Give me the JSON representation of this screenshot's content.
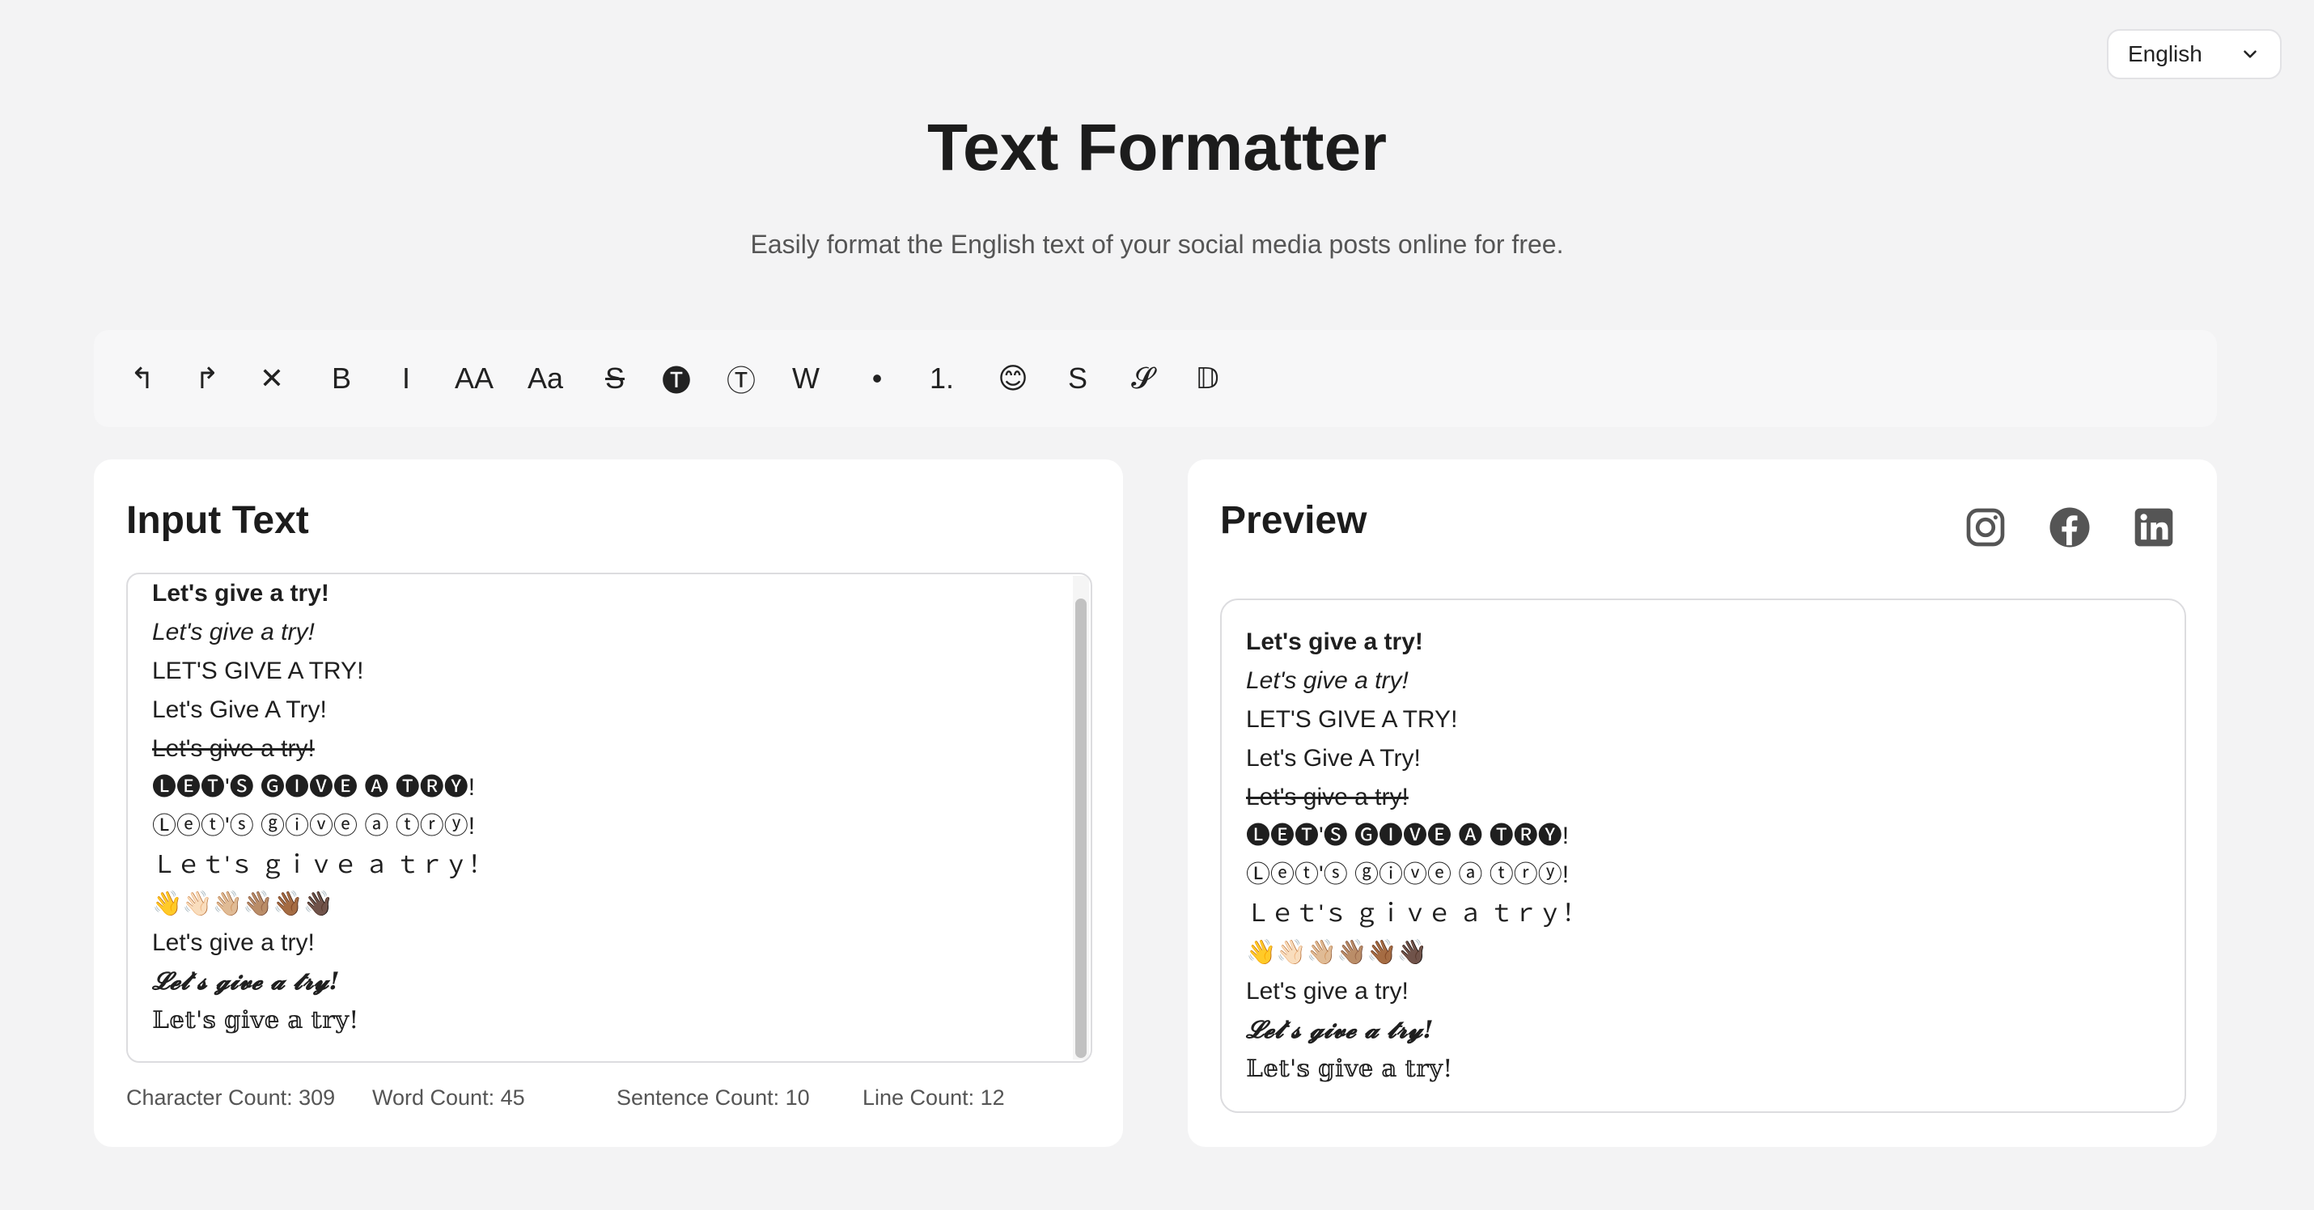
{
  "language": {
    "selected": "English"
  },
  "header": {
    "title": "Text Formatter",
    "subtitle": "Easily format the English text of your social media posts online for free."
  },
  "toolbar": {
    "buttons": [
      {
        "name": "undo",
        "label": "↰"
      },
      {
        "name": "redo",
        "label": "↱"
      },
      {
        "name": "clear",
        "label": "✕"
      },
      {
        "name": "bold",
        "label": "B"
      },
      {
        "name": "italic",
        "label": "I"
      },
      {
        "name": "uppercase",
        "label": "AA"
      },
      {
        "name": "capitalize",
        "label": "Aa"
      },
      {
        "name": "strikethrough",
        "label": "S"
      },
      {
        "name": "circled-filled",
        "label": "🅣"
      },
      {
        "name": "circled-outline",
        "label": "Ⓣ"
      },
      {
        "name": "wide",
        "label": "W"
      },
      {
        "name": "bullet",
        "label": "•"
      },
      {
        "name": "numbered",
        "label": "1."
      },
      {
        "name": "emoji",
        "label": "😊"
      },
      {
        "name": "sans",
        "label": "S"
      },
      {
        "name": "script",
        "label": "𝓢"
      },
      {
        "name": "double-struck",
        "label": "𝔻"
      }
    ]
  },
  "input": {
    "title": "Input Text",
    "lines": [
      "Let's give a try!",
      "Let's give a try!",
      "LET'S GIVE A TRY!",
      "Let's Give A Try!",
      "Let's give a try!",
      "🅛🅔🅣'🅢 🅖🅘🅥🅔 🅐 🅣🅡🅨!",
      "Ⓛⓔⓣ'ⓢ ⓖⓘⓥⓔ ⓐ ⓣⓡⓨ!",
      "Ｌｅｔ'ｓ ｇｉｖｅ ａ ｔｒｙ！",
      "👋👋🏻👋🏼👋🏽👋🏾👋🏿",
      "Let's give a try!",
      "𝓛𝓮𝓽'𝓼 𝓰𝓲𝓿𝓮 𝓪 𝓽𝓻𝔂!",
      "𝕃𝕖𝕥'𝕤 𝕘𝕚𝕧𝕖 𝕒 𝕥𝕣𝕪!"
    ],
    "counts": {
      "characters": "Character Count: 309",
      "words": "Word Count: 45",
      "sentences": "Sentence Count: 10",
      "lines": "Line Count: 12"
    }
  },
  "preview": {
    "title": "Preview",
    "social": [
      "instagram-icon",
      "facebook-icon",
      "linkedin-icon"
    ],
    "lines": [
      "Let's give a try!",
      "Let's give a try!",
      "LET'S GIVE A TRY!",
      "Let's Give A Try!",
      "Let's give a try!",
      "🅛🅔🅣'🅢 🅖🅘🅥🅔 🅐 🅣🅡🅨!",
      "Ⓛⓔⓣ'ⓢ ⓖⓘⓥⓔ ⓐ ⓣⓡⓨ!",
      "Ｌｅｔ'ｓ ｇｉｖｅ ａ ｔｒｙ！",
      "👋👋🏻👋🏼👋🏽👋🏾👋🏿",
      "Let's give a try!",
      "𝓛𝓮𝓽'𝓼 𝓰𝓲𝓿𝓮 𝓪 𝓽𝓻𝔂!",
      "𝕃𝕖𝕥'𝕤 𝕘𝕚𝕧𝕖 𝕒 𝕥𝕣𝕪!"
    ]
  }
}
